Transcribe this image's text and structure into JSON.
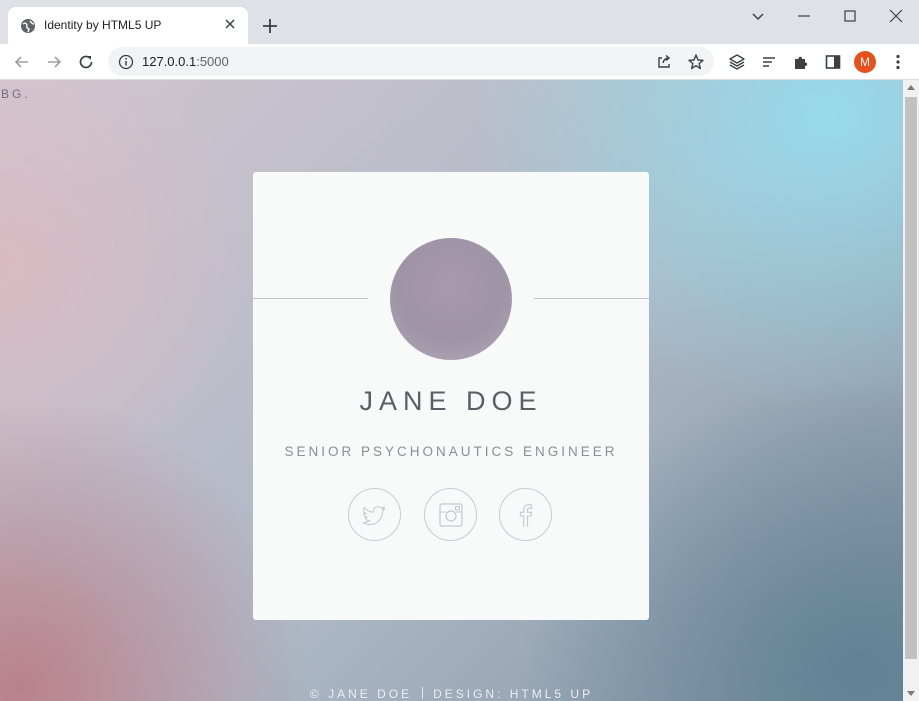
{
  "browser": {
    "tab_title": "Identity by HTML5 UP",
    "url_host": "127.0.0.1",
    "url_port": ":5000",
    "profile_initial": "M",
    "profile_color": "#e8501b"
  },
  "icons": {
    "favicon": "globe-icon",
    "tab_close": "close-icon",
    "new_tab": "plus-icon",
    "back": "arrow-left-icon",
    "forward": "arrow-right-icon",
    "reload": "reload-icon",
    "site_info": "info-icon",
    "share": "share-icon",
    "bookmark": "star-icon",
    "extension_1": "layers-icon",
    "reading_list": "lines-icon",
    "extensions": "puzzle-icon",
    "side_panel": "side-panel-icon",
    "menu": "kebab-icon"
  },
  "page": {
    "bg_label": "BG.",
    "name": "JANE DOE",
    "role": "SENIOR PSYCHONAUTICS ENGINEER",
    "social": [
      "twitter-icon",
      "instagram-icon",
      "facebook-icon"
    ],
    "footer": {
      "copyright": "© JANE DOE",
      "design": "DESIGN: HTML5 UP"
    }
  }
}
